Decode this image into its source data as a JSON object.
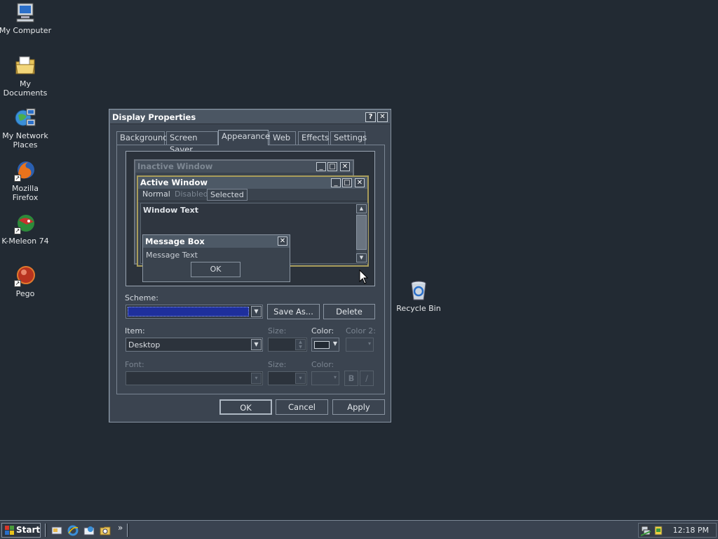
{
  "desktop": {
    "icons": [
      {
        "label": "My Computer",
        "icon": "computer-icon"
      },
      {
        "label": "My Documents",
        "icon": "documents-folder-icon"
      },
      {
        "label": "My Network Places",
        "icon": "network-places-icon"
      },
      {
        "label": "Mozilla Firefox",
        "icon": "firefox-icon"
      },
      {
        "label": "K-Meleon 74",
        "icon": "k-meleon-icon"
      },
      {
        "label": "Pego",
        "icon": "pego-icon"
      },
      {
        "label": "Recycle Bin",
        "icon": "recycle-bin-icon"
      }
    ]
  },
  "dialog": {
    "title": "Display Properties",
    "help": "?",
    "close": "✕",
    "tabs": [
      "Background",
      "Screen Saver",
      "Appearance",
      "Web",
      "Effects",
      "Settings"
    ],
    "active_tab": "Appearance",
    "preview": {
      "inactive_title": "Inactive Window",
      "active_title": "Active Window",
      "menu": [
        "Normal",
        "Disabled",
        "Selected"
      ],
      "window_text": "Window Text",
      "msgbox_title": "Message Box",
      "msgbox_text": "Message Text",
      "msgbox_ok": "OK"
    },
    "scheme_label": "Scheme:",
    "scheme_value": "",
    "save_as": "Save As...",
    "delete": "Delete",
    "item_label": "Item:",
    "item_value": "Desktop",
    "size_label": "Size:",
    "color_label": "Color:",
    "color2_label": "Color 2:",
    "font_label": "Font:",
    "font_size_label": "Size:",
    "font_color_label": "Color:",
    "bold": "B",
    "italic": "/",
    "ok": "OK",
    "cancel": "Cancel",
    "apply": "Apply"
  },
  "taskbar": {
    "start": "Start",
    "chevron": "»",
    "clock": "12:18 PM"
  },
  "colors": {
    "desktop": "#222a33",
    "active_title": "#4b5663",
    "scheme_selection": "#1e2f9c"
  }
}
